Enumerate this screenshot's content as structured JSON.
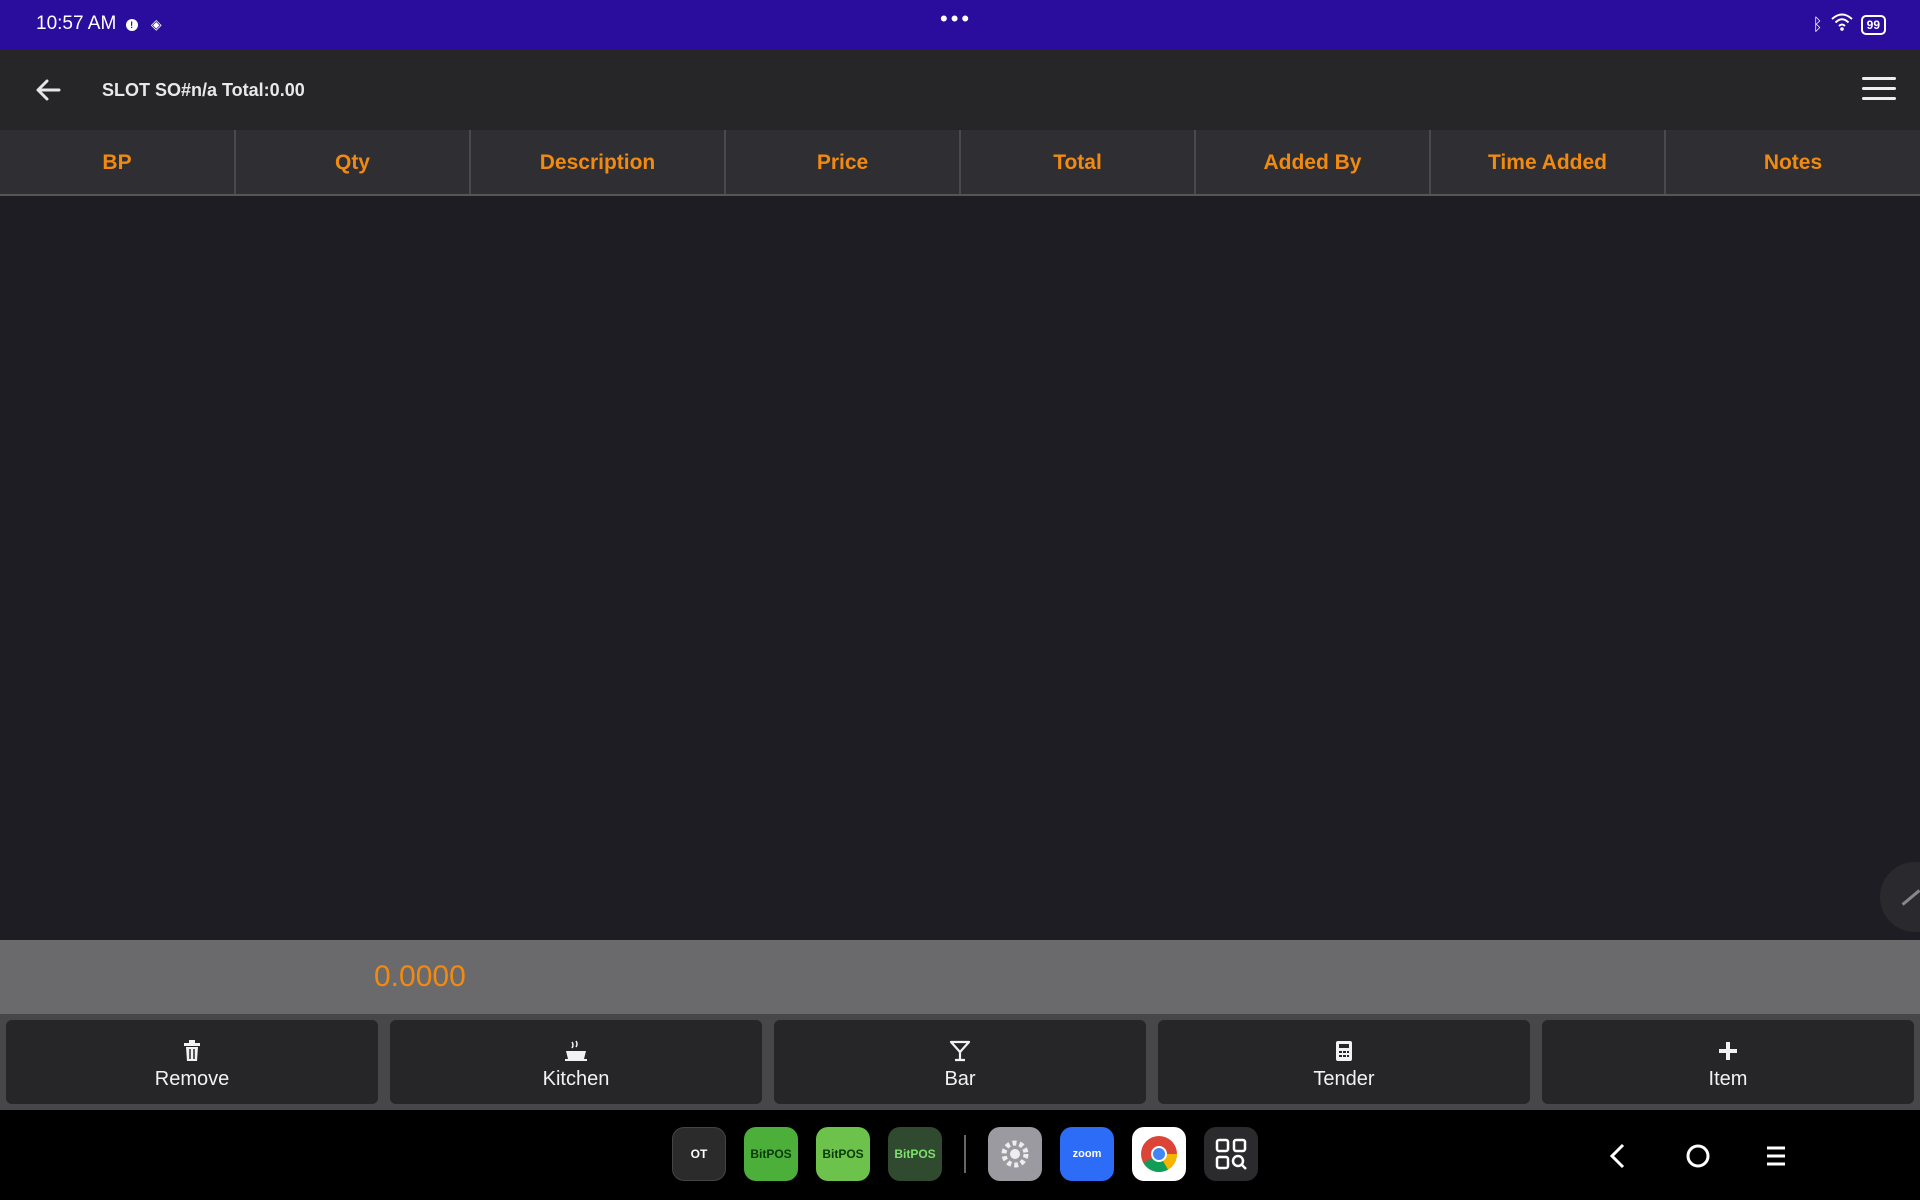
{
  "status_bar": {
    "time": "10:57 AM",
    "center_dots": "•••",
    "battery": "99",
    "icons": [
      "info-icon",
      "cast-icon",
      "bluetooth-icon",
      "wifi-icon",
      "battery-icon"
    ]
  },
  "app_bar": {
    "title": "SLOT SO#n/a Total:0.00"
  },
  "table": {
    "columns": [
      "BP",
      "Qty",
      "Description",
      "Price",
      "Total",
      "Added By",
      "Time Added",
      "Notes"
    ],
    "header_color": "#f08a10",
    "rows": []
  },
  "summary": {
    "value": "0.0000"
  },
  "actions": [
    {
      "label": "Remove",
      "icon": "trash-icon"
    },
    {
      "label": "Kitchen",
      "icon": "cooking-pot-icon"
    },
    {
      "label": "Bar",
      "icon": "cocktail-glass-icon"
    },
    {
      "label": "Tender",
      "icon": "calculator-icon"
    },
    {
      "label": "Item",
      "icon": "plus-icon"
    }
  ],
  "dock": {
    "apps": [
      {
        "name": "motp-app-icon",
        "label": "OT"
      },
      {
        "name": "bitpos-app-icon",
        "label": "BitPOS"
      },
      {
        "name": "bitpos-attendance-app-icon",
        "label": "BitPOS"
      },
      {
        "name": "bitpos-terminal-app-icon",
        "label": "BitPOS"
      },
      {
        "name": "settings-app-icon",
        "label": ""
      },
      {
        "name": "zoom-app-icon",
        "label": "zoom"
      },
      {
        "name": "chrome-app-icon",
        "label": ""
      },
      {
        "name": "app-drawer-icon",
        "label": ""
      }
    ]
  },
  "colors": {
    "status_bar": "#2a0d9c",
    "accent": "#f08a10",
    "app_bar": "#262527",
    "body": "#1e1d23"
  }
}
